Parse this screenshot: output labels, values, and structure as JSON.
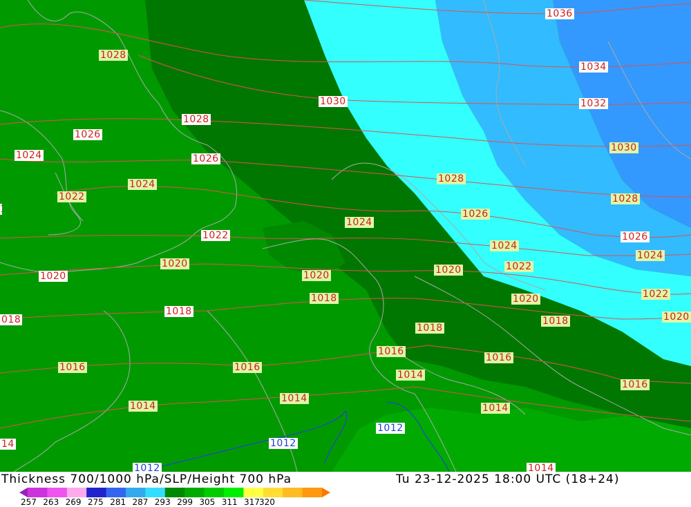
{
  "map": {
    "title": "Thickness 700/1000 hPa/SLP/Height 700 hPa",
    "datetime": "Tu 23-12-2025 18:00 UTC (18+24)",
    "colors": {
      "green_light": "#009900",
      "green_medium": "#008800",
      "green_dark": "#007700",
      "green_bright": "#00b300",
      "cyan": "#33ffff",
      "sky_blue": "#33bbff",
      "blue": "#3399ff",
      "isobar_red": "#e05050",
      "isobar_blue": "#2244cc",
      "coast_gray": "#aaaaaa"
    },
    "isobar_labels": [
      {
        "text": "1036",
        "style": "white"
      },
      {
        "text": "1034",
        "style": "white"
      },
      {
        "text": "1032",
        "style": "white"
      },
      {
        "text": "1030",
        "style": "green"
      },
      {
        "text": "1028",
        "style": "green"
      },
      {
        "text": "1026",
        "style": "white"
      },
      {
        "text": "1024",
        "style": "green"
      },
      {
        "text": "1022",
        "style": "green"
      },
      {
        "text": "1020",
        "style": "green"
      },
      {
        "text": "1030",
        "style": "white"
      },
      {
        "text": "1028",
        "style": "green"
      },
      {
        "text": "1026",
        "style": "green"
      },
      {
        "text": "1024",
        "style": "green"
      },
      {
        "text": "1022",
        "style": "green"
      },
      {
        "text": "1020",
        "style": "green"
      },
      {
        "text": "1028",
        "style": "green"
      },
      {
        "text": "1028",
        "style": "white"
      },
      {
        "text": "1026",
        "style": "white"
      },
      {
        "text": "1024",
        "style": "white"
      },
      {
        "text": "1022",
        "style": "green"
      },
      {
        "text": "1024",
        "style": "green"
      },
      {
        "text": "1026",
        "style": "white"
      },
      {
        "text": "1022",
        "style": "white"
      },
      {
        "text": "1022",
        "style": "white"
      },
      {
        "text": "1020",
        "style": "green"
      },
      {
        "text": "1020",
        "style": "white"
      },
      {
        "text": "1024",
        "style": "green"
      },
      {
        "text": "1020",
        "style": "green"
      },
      {
        "text": "1018",
        "style": "green"
      },
      {
        "text": "1020",
        "style": "green"
      },
      {
        "text": "1020",
        "style": "green"
      },
      {
        "text": "1018",
        "style": "green"
      },
      {
        "text": "1018",
        "style": "white"
      },
      {
        "text": "018",
        "style": "white"
      },
      {
        "text": "1018",
        "style": "green"
      },
      {
        "text": "1016",
        "style": "green"
      },
      {
        "text": "1016",
        "style": "green"
      },
      {
        "text": "1016",
        "style": "green"
      },
      {
        "text": "1016",
        "style": "green"
      },
      {
        "text": "1016",
        "style": "green"
      },
      {
        "text": "1014",
        "style": "green"
      },
      {
        "text": "1014",
        "style": "green"
      },
      {
        "text": "1014",
        "style": "green"
      },
      {
        "text": "1014",
        "style": "green"
      },
      {
        "text": "14",
        "style": "white"
      },
      {
        "text": "1014",
        "style": "white"
      },
      {
        "text": "1012",
        "style": "blue"
      },
      {
        "text": "1012",
        "style": "blue"
      },
      {
        "text": "1012",
        "style": "blue"
      }
    ],
    "legend": {
      "ticks": [
        "257",
        "263",
        "269",
        "275",
        "281",
        "287",
        "293",
        "299",
        "305",
        "311",
        "317",
        "320"
      ],
      "colors": [
        "#9922bb",
        "#cc33dd",
        "#ee55ee",
        "#ffaaee",
        "#2222cc",
        "#3366ee",
        "#33aaee",
        "#33ddff",
        "#008800",
        "#00aa00",
        "#00cc00",
        "#00ee00",
        "#ffff44",
        "#ffdd33",
        "#ffbb22",
        "#ff9911",
        "#ff7700"
      ]
    }
  }
}
